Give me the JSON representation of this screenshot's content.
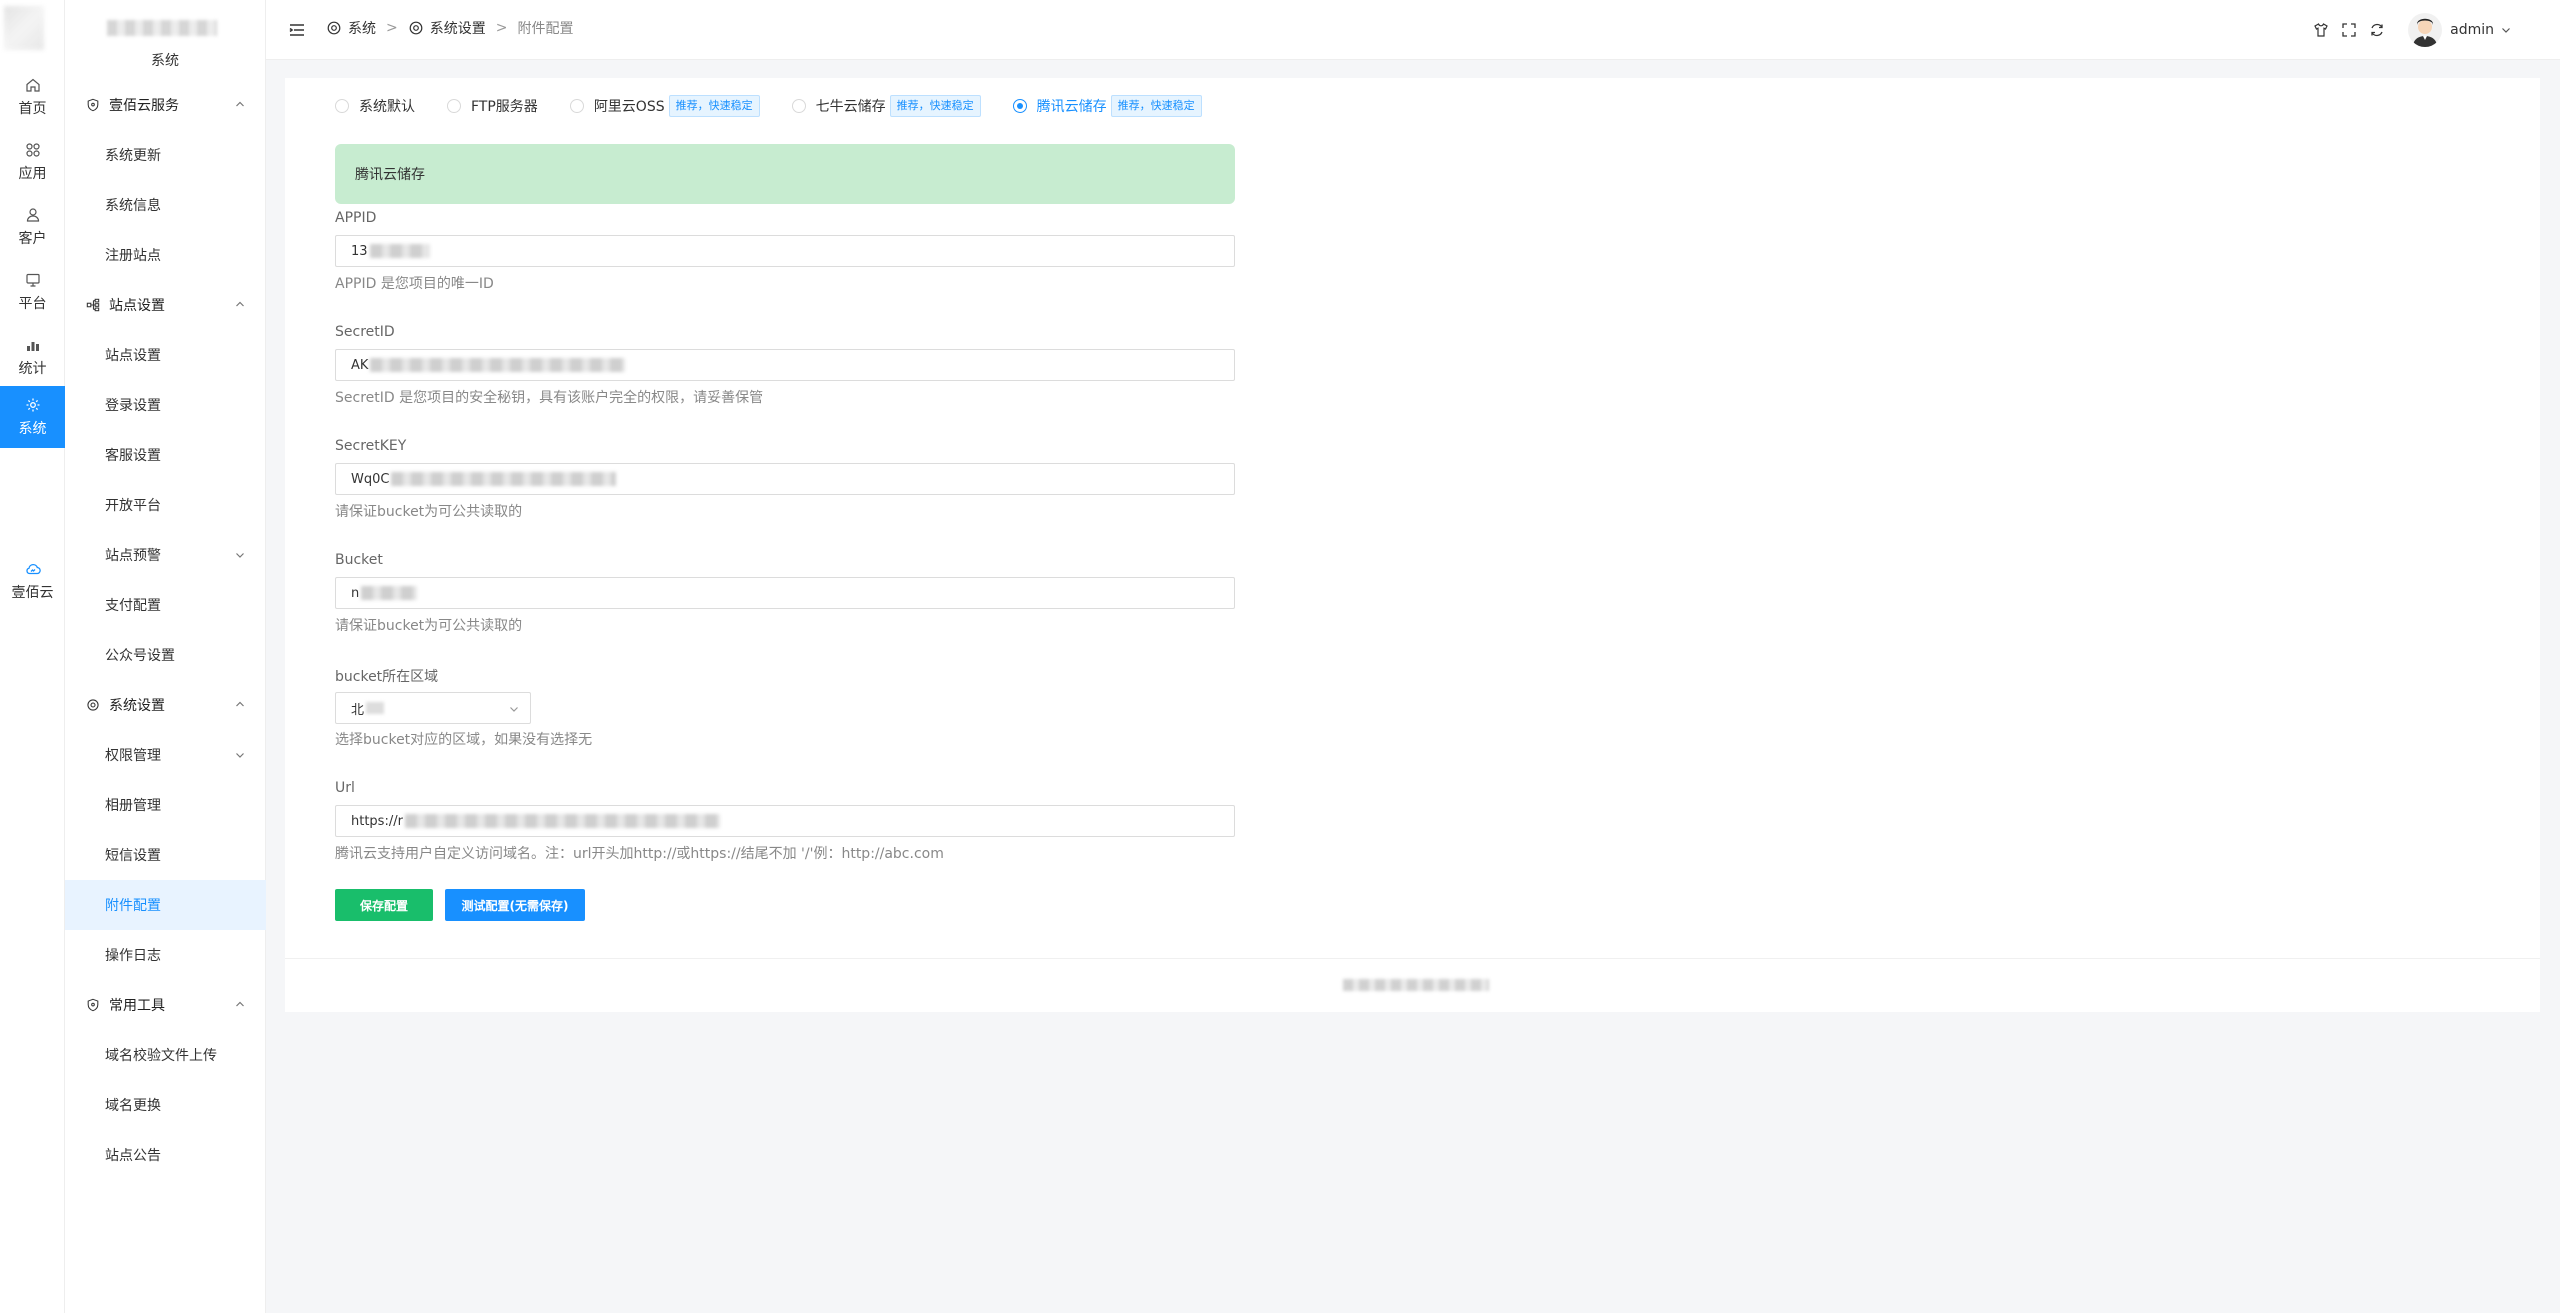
{
  "rail": {
    "items": [
      {
        "label": "首页",
        "icon": "home-icon"
      },
      {
        "label": "应用",
        "icon": "apps-icon"
      },
      {
        "label": "客户",
        "icon": "user-icon"
      },
      {
        "label": "平台",
        "icon": "monitor-icon"
      },
      {
        "label": "统计",
        "icon": "bar-chart-icon"
      },
      {
        "label": "系统",
        "icon": "gear-icon"
      },
      {
        "label": "壹佰云",
        "icon": "cloud-icon"
      }
    ],
    "active_color": "#1890ff"
  },
  "sidebar": {
    "title": "系统",
    "groups": [
      {
        "label": "壹佰云服务",
        "items": [
          "系统更新",
          "系统信息",
          "注册站点"
        ]
      },
      {
        "label": "站点设置",
        "items": [
          "站点设置",
          "登录设置",
          "客服设置",
          "开放平台",
          "站点预警",
          "支付配置",
          "公众号设置"
        ]
      },
      {
        "label": "系统设置",
        "items": [
          "权限管理",
          "相册管理",
          "短信设置",
          "附件配置",
          "操作日志"
        ]
      },
      {
        "label": "常用工具",
        "items": [
          "域名校验文件上传",
          "域名更换",
          "站点公告"
        ]
      }
    ]
  },
  "header": {
    "breadcrumb": [
      "系统",
      "系统设置",
      "附件配置"
    ],
    "separator": ">",
    "user": "admin"
  },
  "storage": {
    "options": [
      {
        "label": "系统默认",
        "tag": ""
      },
      {
        "label": "FTP服务器",
        "tag": ""
      },
      {
        "label": "阿里云OSS",
        "tag": "推荐，快速稳定"
      },
      {
        "label": "七牛云储存",
        "tag": "推荐，快速稳定"
      },
      {
        "label": "腾讯云储存",
        "tag": "推荐，快速稳定"
      }
    ],
    "selected": "腾讯云储存",
    "banner": "腾讯云储存"
  },
  "form": {
    "appid": {
      "label": "APPID",
      "value": "13",
      "help": "APPID 是您项目的唯一ID"
    },
    "secretid": {
      "label": "SecretID",
      "value": "AK",
      "help": "SecretID 是您项目的安全秘钥，具有该账户完全的权限，请妥善保管"
    },
    "secretkey": {
      "label": "SecretKEY",
      "value": "Wq0C",
      "help": "请保证bucket为可公共读取的"
    },
    "bucket": {
      "label": "Bucket",
      "value": "n",
      "help": "请保证bucket为可公共读取的"
    },
    "region": {
      "label": "bucket所在区域",
      "value": "北",
      "help": "选择bucket对应的区域，如果没有选择无"
    },
    "url": {
      "label": "Url",
      "value": "https://r",
      "help": "腾讯云支持用户自定义访问域名。注：url开头加http://或https://结尾不加 '/'例：http://abc.com"
    }
  },
  "buttons": {
    "save": "保存配置",
    "test": "测试配置(无需保存)"
  },
  "colors": {
    "primary": "#1890ff",
    "success": "#19be6b",
    "banner_bg": "#c7ecd0"
  }
}
